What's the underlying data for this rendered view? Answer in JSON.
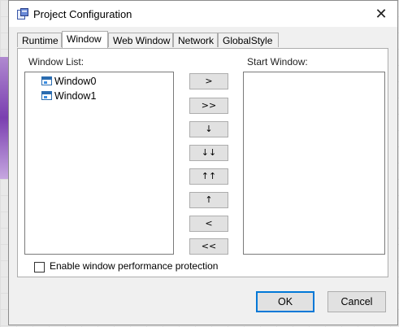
{
  "dialog": {
    "title": "Project Configuration",
    "close_glyph": "✕"
  },
  "tabs": [
    {
      "label": "Runtime",
      "active": false
    },
    {
      "label": "Window",
      "active": true
    },
    {
      "label": "Web Window",
      "active": false
    },
    {
      "label": "Network",
      "active": false
    },
    {
      "label": "GlobalStyle",
      "active": false
    }
  ],
  "window_list": {
    "caption": "Window List:",
    "items": [
      "Window0",
      "Window1"
    ]
  },
  "start_window": {
    "caption": "Start Window:",
    "items": []
  },
  "move_buttons": {
    "add": ">",
    "add_all": ">>",
    "move_down": "↓",
    "move_bottom": "↓↓",
    "move_top": "↑↑",
    "move_up": "↑",
    "remove": "<",
    "remove_all": "<<"
  },
  "options": {
    "performance_protection_label": "Enable window performance protection",
    "performance_protection_checked": false
  },
  "footer": {
    "ok_label": "OK",
    "cancel_label": "Cancel"
  },
  "colors": {
    "accent": "#0078d7",
    "window_icon": "#2b6cb0"
  },
  "icons": {
    "app": "project-icon",
    "list_item": "window-icon"
  }
}
